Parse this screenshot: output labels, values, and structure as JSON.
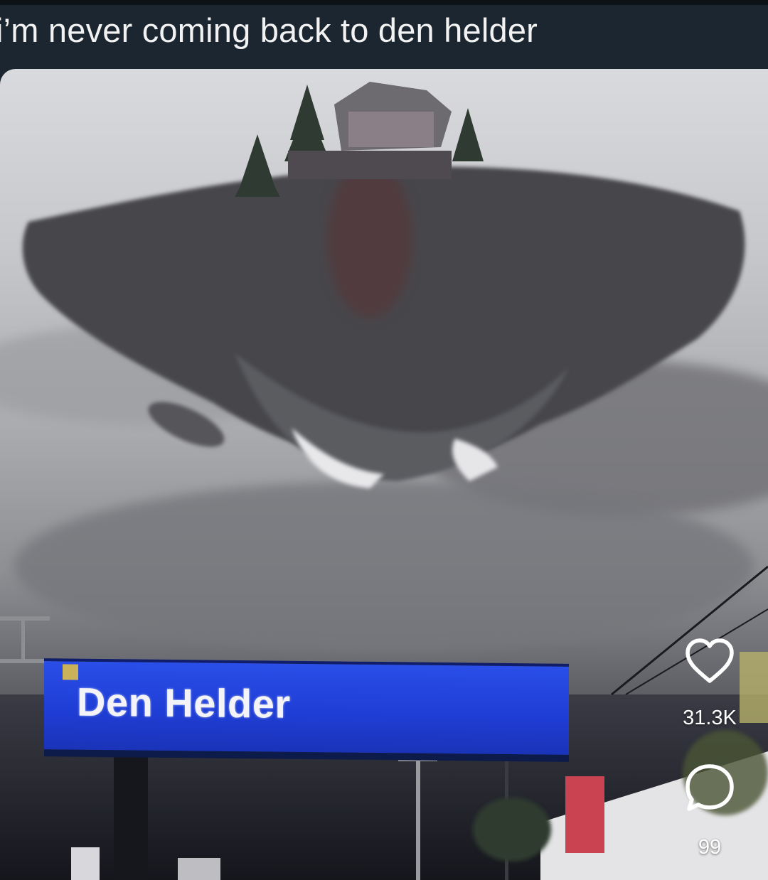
{
  "post": {
    "caption": "i’m never coming back to den helder"
  },
  "media": {
    "sign_text": "Den Helder"
  },
  "actions": {
    "like_count": "31.3K",
    "comment_count": "99",
    "like_icon": "heart-icon",
    "comment_icon": "comment-bubble-icon"
  },
  "colors": {
    "caption_bar": "#1b2630",
    "sign_blue": "#1f3ed6",
    "icon_white": "#ffffff"
  }
}
